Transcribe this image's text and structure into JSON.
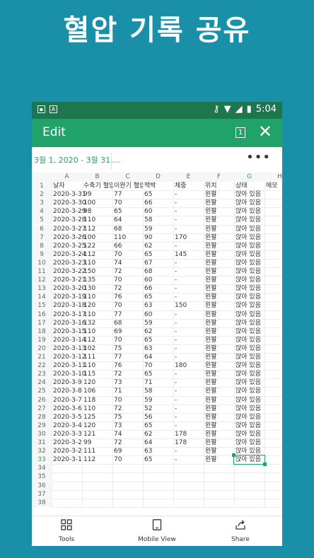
{
  "headline": "혈압 기록 공유",
  "status": {
    "time": "5:04"
  },
  "appbar": {
    "title": "Edit",
    "page_num": "1"
  },
  "formula": {
    "range": "3월 1, 2020 - 3월 31,...",
    "more": "•••"
  },
  "columns": [
    "A",
    "B",
    "C",
    "D",
    "E",
    "F",
    "G",
    "H"
  ],
  "rows": [
    [
      "날자",
      "수축기 혈압",
      "이완기 혈압",
      "맥박",
      "체중",
      "위치",
      "상태",
      "메모"
    ],
    [
      "2020-3-31",
      "99",
      "77",
      "65",
      "-",
      "왼팔",
      "앉아 있음",
      ""
    ],
    [
      "2020-3-30",
      "100",
      "70",
      "66",
      "-",
      "왼팔",
      "앉아 있음",
      ""
    ],
    [
      "2020-3-29",
      "98",
      "65",
      "60",
      "-",
      "왼팔",
      "앉아 있음",
      ""
    ],
    [
      "2020-3-28",
      "110",
      "64",
      "58",
      "-",
      "왼팔",
      "앉아 있음",
      ""
    ],
    [
      "2020-3-27",
      "112",
      "68",
      "59",
      "-",
      "왼팔",
      "앉아 있음",
      ""
    ],
    [
      "2020-3-26",
      "100",
      "110",
      "90",
      "170",
      "왼팔",
      "앉아 있음",
      ""
    ],
    [
      "2020-3-25",
      "122",
      "66",
      "62",
      "-",
      "왼팔",
      "앉아 있음",
      ""
    ],
    [
      "2020-3-24",
      "112",
      "70",
      "65",
      "145",
      "왼팔",
      "앉아 있음",
      ""
    ],
    [
      "2020-3-23",
      "110",
      "74",
      "67",
      "-",
      "왼팔",
      "앉아 있음",
      ""
    ],
    [
      "2020-3-22",
      "150",
      "72",
      "68",
      "-",
      "왼팔",
      "앉아 있음",
      ""
    ],
    [
      "2020-3-21",
      "135",
      "70",
      "60",
      "-",
      "왼팔",
      "앉아 있음",
      ""
    ],
    [
      "2020-3-20",
      "130",
      "72",
      "66",
      "-",
      "왼팔",
      "앉아 있음",
      ""
    ],
    [
      "2020-3-19",
      "110",
      "76",
      "65",
      "-",
      "왼팔",
      "앉아 있음",
      ""
    ],
    [
      "2020-3-18",
      "120",
      "70",
      "63",
      "150",
      "왼팔",
      "앉아 있음",
      ""
    ],
    [
      "2020-3-17",
      "110",
      "77",
      "60",
      "-",
      "왼팔",
      "앉아 있음",
      ""
    ],
    [
      "2020-3-16",
      "132",
      "68",
      "59",
      "-",
      "왼팔",
      "앉아 있음",
      ""
    ],
    [
      "2020-3-15",
      "110",
      "69",
      "62",
      "-",
      "왼팔",
      "앉아 있음",
      ""
    ],
    [
      "2020-3-14",
      "112",
      "70",
      "65",
      "-",
      "왼팔",
      "앉아 있음",
      ""
    ],
    [
      "2020-3-13",
      "102",
      "75",
      "63",
      "-",
      "왼팔",
      "앉아 있음",
      ""
    ],
    [
      "2020-3-12",
      "111",
      "77",
      "64",
      "-",
      "왼팔",
      "앉아 있음",
      ""
    ],
    [
      "2020-3-11",
      "110",
      "76",
      "70",
      "180",
      "왼팔",
      "앉아 있음",
      ""
    ],
    [
      "2020-3-10",
      "115",
      "72",
      "65",
      "-",
      "왼팔",
      "앉아 있음",
      ""
    ],
    [
      "2020-3-9",
      "120",
      "73",
      "71",
      "-",
      "왼팔",
      "앉아 있음",
      ""
    ],
    [
      "2020-3-8",
      "106",
      "71",
      "58",
      "-",
      "왼팔",
      "앉아 있음",
      ""
    ],
    [
      "2020-3-7",
      "118",
      "70",
      "59",
      "-",
      "왼팔",
      "앉아 있음",
      ""
    ],
    [
      "2020-3-6",
      "110",
      "72",
      "52",
      "-",
      "왼팔",
      "앉아 있음",
      ""
    ],
    [
      "2020-3-5",
      "125",
      "75",
      "56",
      "-",
      "왼팔",
      "앉아 있음",
      ""
    ],
    [
      "2020-3-4",
      "120",
      "73",
      "65",
      "-",
      "왼팔",
      "앉아 있음",
      ""
    ],
    [
      "2020-3-3",
      "121",
      "74",
      "62",
      "178",
      "왼팔",
      "앉아 있음",
      ""
    ],
    [
      "2020-3-2",
      "99",
      "72",
      "64",
      "178",
      "왼팔",
      "앉아 있음",
      ""
    ],
    [
      "2020-3-2",
      "111",
      "69",
      "63",
      "-",
      "왼팔",
      "앉아 있음",
      ""
    ],
    [
      "2020-3-1",
      "112",
      "70",
      "65",
      "-",
      "왼팔",
      "앉아 있음",
      ""
    ]
  ],
  "empty_rows": [
    "34",
    "35",
    "36",
    "37",
    "38"
  ],
  "bottombar": {
    "tools": "Tools",
    "mobile_view": "Mobile View",
    "share": "Share"
  },
  "colors": {
    "accent": "#21a26a",
    "status_bar": "#1d7650",
    "background": "#1a8fa8"
  }
}
